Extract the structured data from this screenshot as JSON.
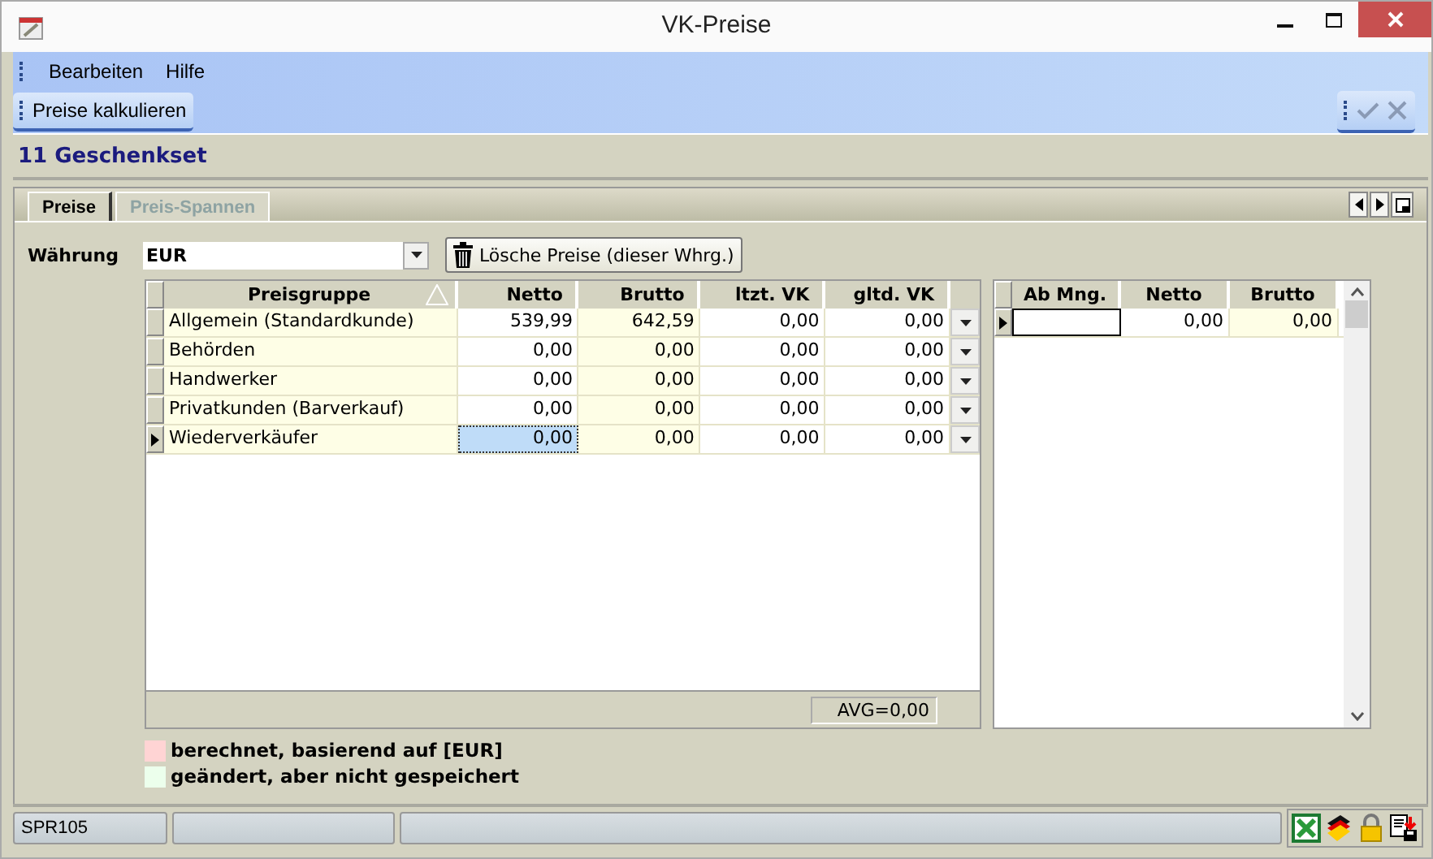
{
  "window": {
    "title": "VK-Preise"
  },
  "menu": [
    "Bearbeiten",
    "Hilfe"
  ],
  "toolbar": {
    "button": "Preise kalkulieren"
  },
  "heading": "11 Geschenkset",
  "tabs": [
    {
      "label": "Preise",
      "selected": true
    },
    {
      "label": "Preis-Spannen",
      "selected": false
    }
  ],
  "currency": {
    "label": "Währung",
    "value": "EUR",
    "delete_button": "Lösche Preise (dieser Whrg.)"
  },
  "price_table": {
    "columns": [
      {
        "label": "Preisgruppe",
        "sorted": true
      },
      {
        "label": "Netto",
        "sorted": false
      },
      {
        "label": "Brutto",
        "sorted": false
      },
      {
        "label": "ltzt. VK",
        "sorted": false
      },
      {
        "label": "gltd. VK",
        "sorted": false
      }
    ],
    "rows": [
      {
        "cells": [
          "Allgemein (Standardkunde)",
          "539,99",
          "642,59",
          "0,00",
          "0,00"
        ],
        "selected": false
      },
      {
        "cells": [
          "Behörden",
          "0,00",
          "0,00",
          "0,00",
          "0,00"
        ],
        "selected": false
      },
      {
        "cells": [
          "Handwerker",
          "0,00",
          "0,00",
          "0,00",
          "0,00"
        ],
        "selected": false
      },
      {
        "cells": [
          "Privatkunden (Barverkauf)",
          "0,00",
          "0,00",
          "0,00",
          "0,00"
        ],
        "selected": false
      },
      {
        "cells": [
          "Wiederverkäufer",
          "0,00",
          "0,00",
          "0,00",
          "0,00"
        ],
        "selected": true
      }
    ],
    "footer": "AVG=0,00"
  },
  "quantity_table": {
    "columns": [
      "Ab Mng.",
      "Netto",
      "Brutto"
    ],
    "rows": [
      {
        "cells": [
          "",
          "0,00",
          "0,00"
        ],
        "selected": true
      }
    ]
  },
  "legend": [
    {
      "label": "berechnet, basierend auf [EUR]",
      "color": "#ffd4d4"
    },
    {
      "label": "geändert, aber nicht gespeichert",
      "color": "#ecffec"
    }
  ],
  "status_bar": {
    "panels": [
      "SPR105"
    ]
  }
}
